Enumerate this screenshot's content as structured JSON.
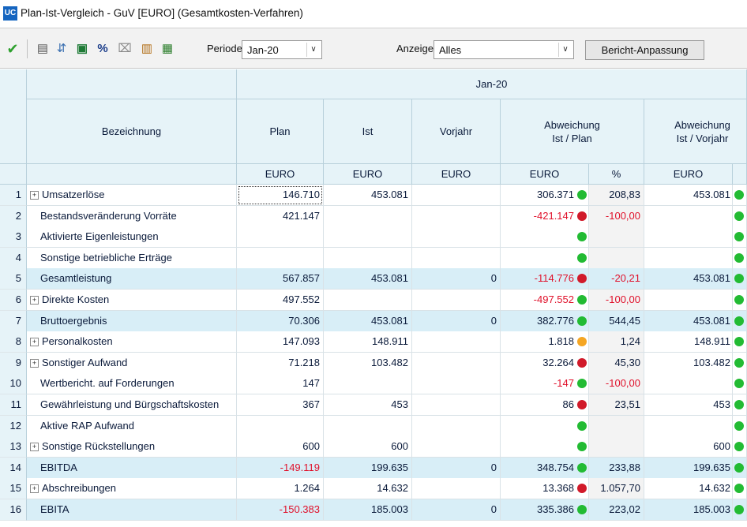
{
  "window": {
    "app_icon": "UC",
    "title": "Plan-Ist-Vergleich - GuV  [EURO] (Gesamtkosten-Verfahren)"
  },
  "toolbar": {
    "periode_label": "Periode",
    "periode_value": "Jan-20",
    "anzeige_label": "Anzeige",
    "anzeige_value": "Alles",
    "report_button": "Bericht-Anpassung",
    "icons": [
      "check-icon",
      "print-icon",
      "filter-icon",
      "excel-icon",
      "percent-icon",
      "trash-icon",
      "chart-icon",
      "calculator-icon"
    ]
  },
  "table": {
    "period_header": "Jan-20",
    "col_bezeichnung": "Bezeichnung",
    "col_plan": "Plan",
    "col_ist": "Ist",
    "col_vorjahr": "Vorjahr",
    "col_abw_plan_1": "Abweichung",
    "col_abw_plan_2": "Ist / Plan",
    "col_abw_vj_1": "Abweichung",
    "col_abw_vj_2": "Ist / Vorjahr",
    "unit_euro": "EURO",
    "unit_pct": "%",
    "rows": [
      {
        "n": "1",
        "exp": true,
        "name": "Umsatzerlöse",
        "plan": "146.710",
        "ist": "453.081",
        "vj": "",
        "abw": "306.371",
        "abw_neg": false,
        "dot": "green",
        "pct": "208,83",
        "pct_neg": false,
        "abwvj": "453.081",
        "dotvj": "green",
        "hl": false
      },
      {
        "n": "2",
        "exp": false,
        "name": "Bestandsveränderung Vorräte",
        "plan": "421.147",
        "ist": "",
        "vj": "",
        "abw": "-421.147",
        "abw_neg": true,
        "dot": "red",
        "pct": "-100,00",
        "pct_neg": true,
        "abwvj": "",
        "dotvj": "green",
        "hl": false
      },
      {
        "n": "3",
        "exp": false,
        "name": "Aktivierte Eigenleistungen",
        "plan": "",
        "ist": "",
        "vj": "",
        "abw": "",
        "abw_neg": false,
        "dot": "green",
        "pct": "",
        "pct_neg": false,
        "abwvj": "",
        "dotvj": "green",
        "hl": false
      },
      {
        "n": "4",
        "exp": false,
        "name": "Sonstige betriebliche Erträge",
        "plan": "",
        "ist": "",
        "vj": "",
        "abw": "",
        "abw_neg": false,
        "dot": "green",
        "pct": "",
        "pct_neg": false,
        "abwvj": "",
        "dotvj": "green",
        "hl": false
      },
      {
        "n": "5",
        "exp": false,
        "name": "Gesamtleistung",
        "plan": "567.857",
        "ist": "453.081",
        "vj": "0",
        "abw": "-114.776",
        "abw_neg": true,
        "dot": "red",
        "pct": "-20,21",
        "pct_neg": true,
        "abwvj": "453.081",
        "dotvj": "green",
        "hl": true
      },
      {
        "n": "6",
        "exp": true,
        "name": "Direkte Kosten",
        "plan": "497.552",
        "ist": "",
        "vj": "",
        "abw": "-497.552",
        "abw_neg": true,
        "dot": "green",
        "pct": "-100,00",
        "pct_neg": true,
        "abwvj": "",
        "dotvj": "green",
        "hl": false
      },
      {
        "n": "7",
        "exp": false,
        "name": "Bruttoergebnis",
        "plan": "70.306",
        "ist": "453.081",
        "vj": "0",
        "abw": "382.776",
        "abw_neg": false,
        "dot": "green",
        "pct": "544,45",
        "pct_neg": false,
        "abwvj": "453.081",
        "dotvj": "green",
        "hl": true
      },
      {
        "n": "8",
        "exp": true,
        "name": "Personalkosten",
        "plan": "147.093",
        "ist": "148.911",
        "vj": "",
        "abw": "1.818",
        "abw_neg": false,
        "dot": "orange",
        "pct": "1,24",
        "pct_neg": false,
        "abwvj": "148.911",
        "dotvj": "green",
        "hl": false
      },
      {
        "n": "9",
        "exp": true,
        "name": "Sonstiger Aufwand",
        "plan": "71.218",
        "ist": "103.482",
        "vj": "",
        "abw": "32.264",
        "abw_neg": false,
        "dot": "red",
        "pct": "45,30",
        "pct_neg": false,
        "abwvj": "103.482",
        "dotvj": "green",
        "hl": false
      },
      {
        "n": "10",
        "exp": false,
        "name": "Wertbericht. auf Forderungen",
        "plan": "147",
        "ist": "",
        "vj": "",
        "abw": "-147",
        "abw_neg": true,
        "dot": "green",
        "pct": "-100,00",
        "pct_neg": true,
        "abwvj": "",
        "dotvj": "green",
        "hl": false
      },
      {
        "n": "11",
        "exp": false,
        "name": "Gewährleistung und Bürgschaftskosten",
        "plan": "367",
        "ist": "453",
        "vj": "",
        "abw": "86",
        "abw_neg": false,
        "dot": "red",
        "pct": "23,51",
        "pct_neg": false,
        "abwvj": "453",
        "dotvj": "green",
        "hl": false
      },
      {
        "n": "12",
        "exp": false,
        "name": "Aktive RAP Aufwand",
        "plan": "",
        "ist": "",
        "vj": "",
        "abw": "",
        "abw_neg": false,
        "dot": "green",
        "pct": "",
        "pct_neg": false,
        "abwvj": "",
        "dotvj": "green",
        "hl": false
      },
      {
        "n": "13",
        "exp": true,
        "name": "Sonstige Rückstellungen",
        "plan": "600",
        "ist": "600",
        "vj": "",
        "abw": "",
        "abw_neg": false,
        "dot": "green",
        "pct": "",
        "pct_neg": false,
        "abwvj": "600",
        "dotvj": "green",
        "hl": false
      },
      {
        "n": "14",
        "exp": false,
        "name": "EBITDA",
        "plan": "-149.119",
        "plan_neg": true,
        "ist": "199.635",
        "vj": "0",
        "abw": "348.754",
        "abw_neg": false,
        "dot": "green",
        "pct": "233,88",
        "pct_neg": false,
        "abwvj": "199.635",
        "dotvj": "green",
        "hl": true
      },
      {
        "n": "15",
        "exp": true,
        "name": "Abschreibungen",
        "plan": "1.264",
        "ist": "14.632",
        "vj": "",
        "abw": "13.368",
        "abw_neg": false,
        "dot": "red",
        "pct": "1.057,70",
        "pct_neg": false,
        "abwvj": "14.632",
        "dotvj": "green",
        "hl": false
      },
      {
        "n": "16",
        "exp": false,
        "name": "EBITA",
        "plan": "-150.383",
        "plan_neg": true,
        "ist": "185.003",
        "vj": "0",
        "abw": "335.386",
        "abw_neg": false,
        "dot": "green",
        "pct": "223,02",
        "pct_neg": false,
        "abwvj": "185.003",
        "dotvj": "green",
        "hl": true
      }
    ]
  }
}
